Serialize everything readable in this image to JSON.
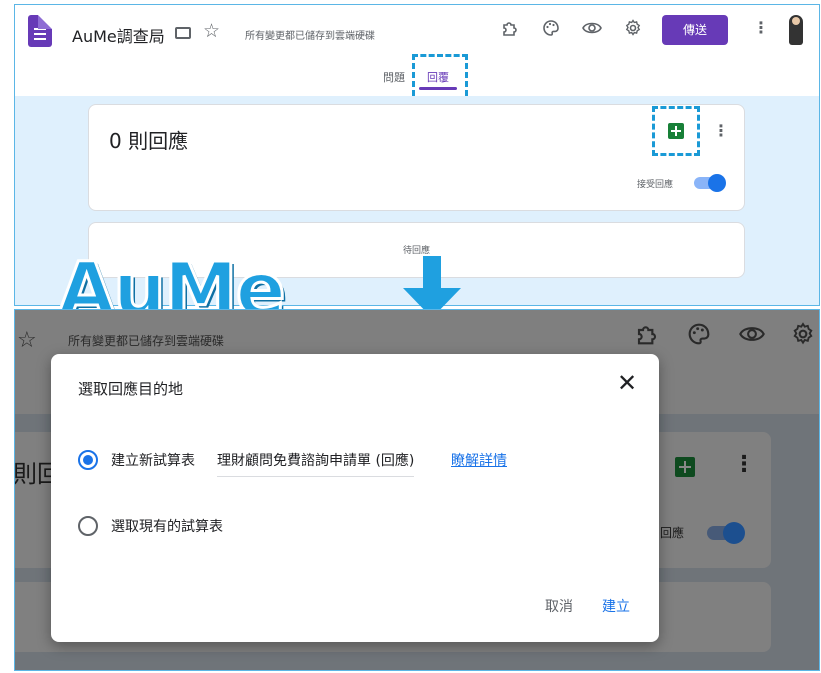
{
  "header": {
    "app_title": "AuMe調查局",
    "save_status": "所有變更都已儲存到雲端硬碟",
    "send_label": "傳送",
    "icons": [
      "forms-logo-icon",
      "folder-icon",
      "star-icon",
      "addon-icon",
      "palette-icon",
      "eye-icon",
      "gear-icon",
      "more-vert-icon",
      "avatar"
    ]
  },
  "tabs": {
    "questions": "問題",
    "responses": "回覆"
  },
  "responses_card": {
    "count_text": "0 則回應",
    "accept_label": "接受回應",
    "accepting": true,
    "waiting_text": "待回應"
  },
  "watermark": {
    "text": "AuMe"
  },
  "bottom_panel": {
    "save_status": "所有變更都已儲存到雲端硬碟",
    "partial_heading": "則回",
    "accept_label": "回應"
  },
  "dialog": {
    "title": "選取回應目的地",
    "close_symbol": "✕",
    "option_new": {
      "label": "建立新試算表",
      "sheet_name": "理財顧問免費諮詢申請單 (回應)",
      "learn_more": "瞭解詳情",
      "selected": true
    },
    "option_existing": {
      "label": "選取現有的試算表",
      "selected": false
    },
    "cancel_label": "取消",
    "create_label": "建立"
  },
  "colors": {
    "brand_purple": "#673ab7",
    "accent_blue": "#1a73e8",
    "sheets_green": "#188038",
    "highlight_cyan": "#1a9ad6"
  }
}
